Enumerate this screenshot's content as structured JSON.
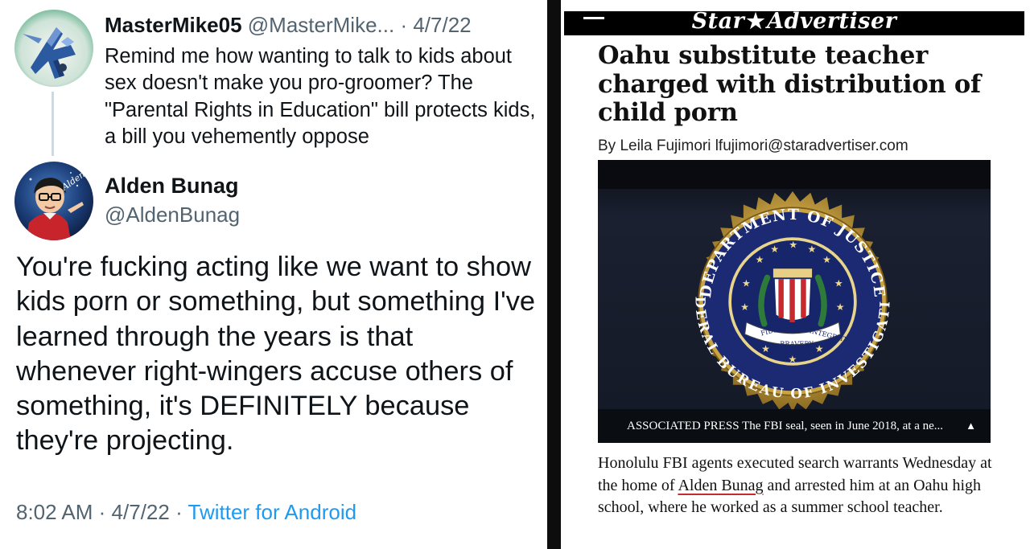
{
  "reply_tweet": {
    "display_name": "MasterMike05",
    "handle": "@MasterMike...",
    "separator": "·",
    "date": "4/7/22",
    "text": "Remind me how wanting to talk to kids about sex doesn't make you pro-groomer? The \"Parental Rights in Education\" bill protects kids, a bill you vehemently oppose"
  },
  "main_tweet": {
    "display_name": "Alden Bunag",
    "handle": "@AldenBunag",
    "text": "You're fucking acting like we want to show kids porn or something, but something I've learned through the years is that whenever right-wingers accuse others of something, it's DEFINITELY because they're projecting.",
    "avatar_signature": "Alden",
    "time": "8:02 AM",
    "separator": "·",
    "date": "4/7/22",
    "source": "Twitter for Android"
  },
  "article": {
    "masthead": {
      "logo_left": "Star",
      "logo_star": "★",
      "logo_right": "Advertiser",
      "menu_icon": "hamburger-menu-icon"
    },
    "headline": "Oahu substitute teacher charged with distribution of child porn",
    "byline": "By Leila Fujimori lfujimori@staradvertiser.com",
    "photo": {
      "seal_top_text": "DEPARTMENT OF JUSTICE",
      "seal_bottom_text": "FEDERAL BUREAU OF INVESTIGATION",
      "ribbon_left": "FIDELITY",
      "ribbon_middle": "BRAVERY",
      "ribbon_right": "INTEGRITY",
      "caption": "ASSOCIATED PRESS The FBI seal, seen in June 2018, at a ne...",
      "caption_toggle": "▲"
    },
    "body": {
      "before": "Honolulu FBI agents executed search warrants Wednesday at the home of ",
      "highlight": "Alden Bunag",
      "after": " and arrested him at an Oahu high school, where he worked as a summer school teacher."
    }
  },
  "colors": {
    "link_blue": "#1d9bf0",
    "muted_gray": "#536471",
    "underline_red": "#c82a2a",
    "seal_gold": "#c9a445",
    "seal_blue": "#17266b"
  }
}
